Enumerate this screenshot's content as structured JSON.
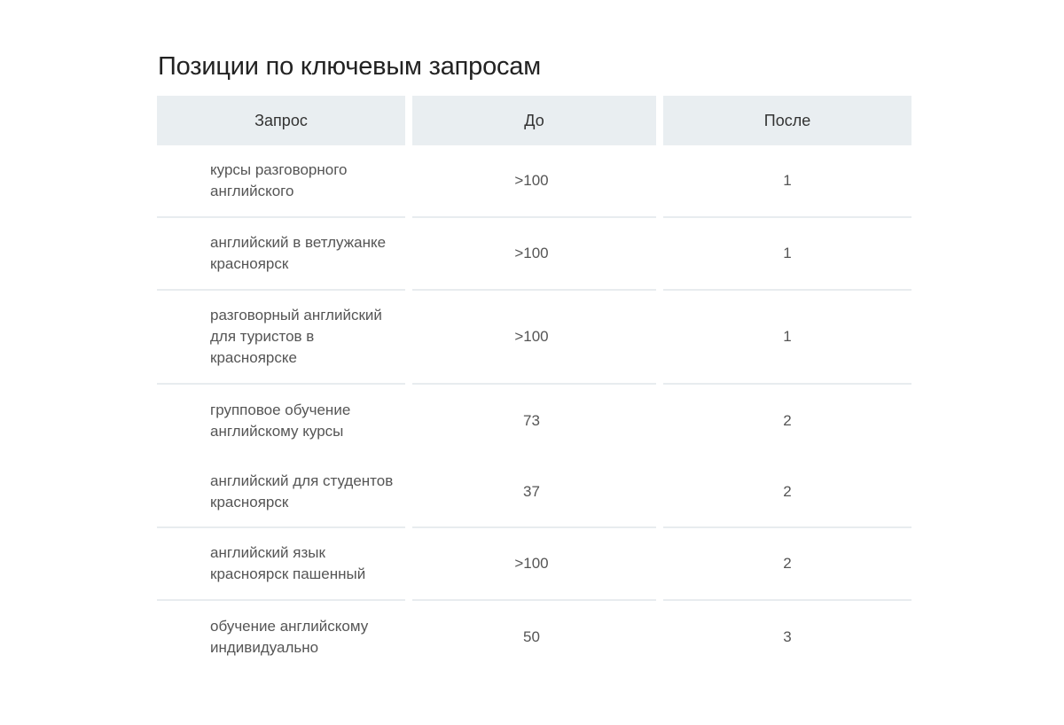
{
  "title": "Позиции по ключевым запросам",
  "table": {
    "headers": [
      "Запрос",
      "До",
      "После"
    ],
    "rows": [
      {
        "query": "курсы разговорного английского",
        "before": ">100",
        "after": "1"
      },
      {
        "query": "английский в ветлужанке красноярск",
        "before": ">100",
        "after": "1"
      },
      {
        "query": "разговорный английский для туристов в красноярске",
        "before": ">100",
        "after": "1"
      },
      {
        "query": "групповое обучение английскому курсы",
        "before": "73",
        "after": "2"
      },
      {
        "query": "английский для студентов красноярск",
        "before": "37",
        "after": "2"
      },
      {
        "query": "английский язык красноярск пашенный",
        "before": ">100",
        "after": "2"
      },
      {
        "query": "обучение английскому индивидуально",
        "before": "50",
        "after": "3"
      }
    ]
  }
}
